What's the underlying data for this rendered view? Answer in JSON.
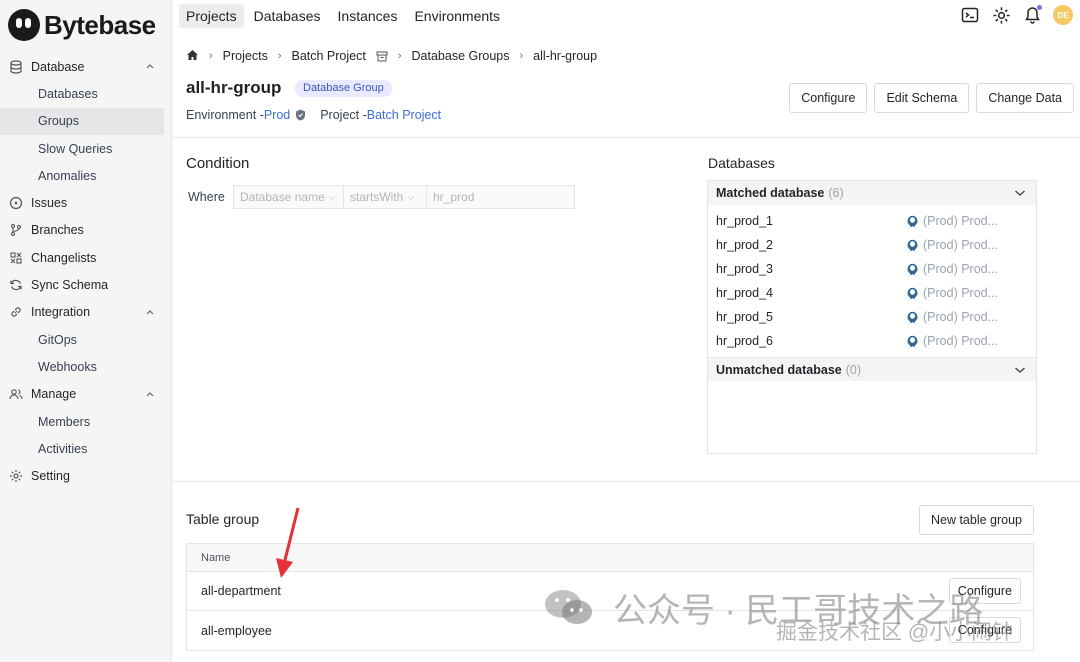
{
  "app": {
    "name": "Bytebase"
  },
  "sidebar": {
    "items": [
      {
        "label": "Database",
        "icon": "database-icon",
        "type": "section"
      },
      {
        "label": "Databases",
        "type": "sub"
      },
      {
        "label": "Groups",
        "type": "sub",
        "active": true
      },
      {
        "label": "Slow Queries",
        "type": "sub"
      },
      {
        "label": "Anomalies",
        "type": "sub"
      },
      {
        "label": "Issues",
        "icon": "issues-icon",
        "type": "item"
      },
      {
        "label": "Branches",
        "icon": "branch-icon",
        "type": "item"
      },
      {
        "label": "Changelists",
        "icon": "changelist-icon",
        "type": "item"
      },
      {
        "label": "Sync Schema",
        "icon": "sync-icon",
        "type": "item"
      },
      {
        "label": "Integration",
        "icon": "link-icon",
        "type": "section"
      },
      {
        "label": "GitOps",
        "type": "sub"
      },
      {
        "label": "Webhooks",
        "type": "sub"
      },
      {
        "label": "Manage",
        "icon": "users-icon",
        "type": "section"
      },
      {
        "label": "Members",
        "type": "sub"
      },
      {
        "label": "Activities",
        "type": "sub"
      },
      {
        "label": "Setting",
        "icon": "gear-icon",
        "type": "item"
      }
    ]
  },
  "topnav": {
    "tabs": [
      {
        "label": "Projects",
        "active": true
      },
      {
        "label": "Databases"
      },
      {
        "label": "Instances"
      },
      {
        "label": "Environments"
      }
    ],
    "avatar": "DE"
  },
  "breadcrumb": {
    "items": [
      "Projects",
      "Batch Project",
      "Database Groups",
      "all-hr-group"
    ]
  },
  "header": {
    "title": "all-hr-group",
    "badge": "Database Group",
    "env_label": "Environment - ",
    "env_value": "Prod",
    "project_label": "Project - ",
    "project_value": "Batch Project",
    "buttons": {
      "configure": "Configure",
      "edit_schema": "Edit Schema",
      "change_data": "Change Data"
    }
  },
  "condition": {
    "title": "Condition",
    "where": "Where",
    "field": "Database name",
    "operator": "startsWith",
    "value": "hr_prod"
  },
  "databases": {
    "title": "Databases",
    "matched_label": "Matched database",
    "matched_count": "(6)",
    "matched": [
      {
        "name": "hr_prod_1",
        "env": "(Prod) Prod..."
      },
      {
        "name": "hr_prod_2",
        "env": "(Prod) Prod..."
      },
      {
        "name": "hr_prod_3",
        "env": "(Prod) Prod..."
      },
      {
        "name": "hr_prod_4",
        "env": "(Prod) Prod..."
      },
      {
        "name": "hr_prod_5",
        "env": "(Prod) Prod..."
      },
      {
        "name": "hr_prod_6",
        "env": "(Prod) Prod..."
      }
    ],
    "unmatched_label": "Unmatched database",
    "unmatched_count": "(0)"
  },
  "table_group": {
    "title": "Table group",
    "new_button": "New table group",
    "column": "Name",
    "rows": [
      {
        "name": "all-department",
        "action": "Configure"
      },
      {
        "name": "all-employee",
        "action": "Configure"
      }
    ]
  },
  "watermark": {
    "line1": "公众号 · 民工哥技术之路",
    "line2": "掘金技术社区 @小小闹钟"
  },
  "colors": {
    "accent": "#3b6fd6",
    "badge_bg": "#e8ebff",
    "badge_text": "#4552c4",
    "arrow": "#e5323a"
  }
}
